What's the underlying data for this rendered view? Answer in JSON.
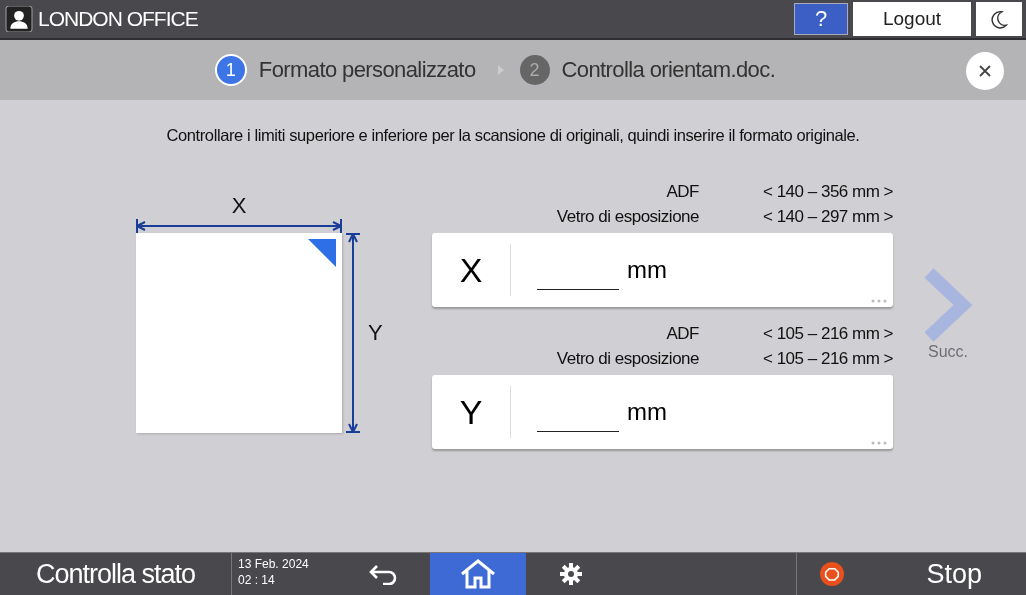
{
  "header": {
    "user": "LONDON OFFICE",
    "help": "?",
    "logout": "Logout"
  },
  "steps": [
    {
      "number": "1",
      "label": "Formato personalizzato",
      "selected": true
    },
    {
      "number": "2",
      "label": "Controlla orientam.doc.",
      "selected": false
    }
  ],
  "instruction": "Controllare i limiti superiore e inferiore per la scansione di originali, quindi inserire il formato originale.",
  "diagram": {
    "x_label": "X",
    "y_label": "Y"
  },
  "fields": [
    {
      "axis": "X",
      "unit": "mm",
      "ranges": [
        {
          "source": "ADF",
          "range": "< 140 – 356 mm >"
        },
        {
          "source": "Vetro di esposizione",
          "range": "< 140 – 297 mm >"
        }
      ]
    },
    {
      "axis": "Y",
      "unit": "mm",
      "ranges": [
        {
          "source": "ADF",
          "range": "< 105 – 216 mm >"
        },
        {
          "source": "Vetro di esposizione",
          "range": "< 105 – 216 mm >"
        }
      ]
    }
  ],
  "next": {
    "label": "Succ.",
    "disabled": true
  },
  "bottom": {
    "status": "Controlla stato",
    "date": "13 Feb. 2024",
    "time": "02 : 14",
    "stop": "Stop",
    "buttons": [
      {
        "kind": "back",
        "selected": false
      },
      {
        "kind": "home",
        "selected": true
      },
      {
        "kind": "settings",
        "selected": false
      }
    ]
  }
}
